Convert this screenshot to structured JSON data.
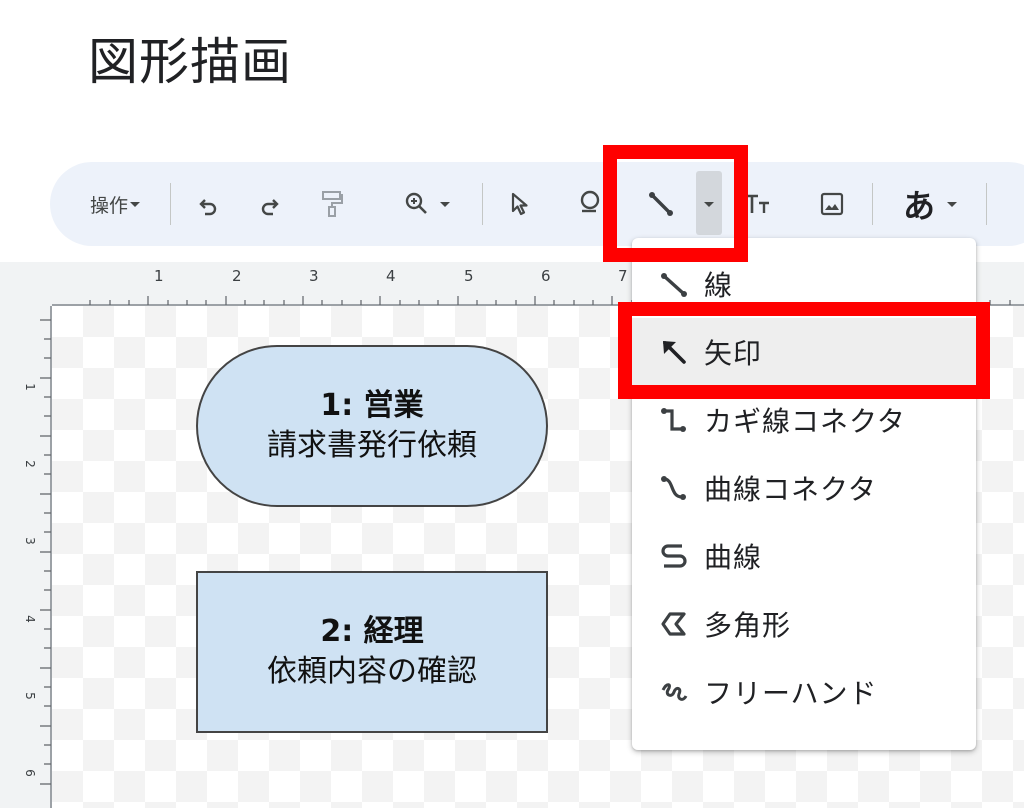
{
  "page": {
    "title": "図形描画"
  },
  "toolbar": {
    "menu_label": "操作",
    "text_style_label": "あ",
    "icons": [
      "undo-icon",
      "redo-icon",
      "paint-format-icon",
      "zoom-icon",
      "select-icon",
      "shape-icon",
      "line-icon",
      "textbox-icon",
      "image-icon"
    ]
  },
  "ruler": {
    "top": [
      "1",
      "2",
      "3",
      "4",
      "5",
      "6",
      "7"
    ],
    "left": [
      "1",
      "2",
      "3",
      "4",
      "5",
      "6"
    ]
  },
  "canvas": {
    "shapes": [
      {
        "title": "1: 営業",
        "text": "請求書発行依頼",
        "fill": "#cfe2f3"
      },
      {
        "title": "2: 経理",
        "text": "依頼内容の確認",
        "fill": "#cfe2f3"
      }
    ]
  },
  "line_menu": {
    "items": [
      {
        "label": "線",
        "icon": "line-icon"
      },
      {
        "label": "矢印",
        "icon": "arrow-icon"
      },
      {
        "label": "カギ線コネクタ",
        "icon": "elbow-connector-icon"
      },
      {
        "label": "曲線コネクタ",
        "icon": "curved-connector-icon"
      },
      {
        "label": "曲線",
        "icon": "curve-icon"
      },
      {
        "label": "多角形",
        "icon": "polyline-icon"
      },
      {
        "label": "フリーハンド",
        "icon": "scribble-icon"
      }
    ]
  },
  "colors": {
    "highlight": "#ff0000",
    "toolbar_bg": "#edf2fa",
    "shape_fill": "#cfe2f3"
  }
}
